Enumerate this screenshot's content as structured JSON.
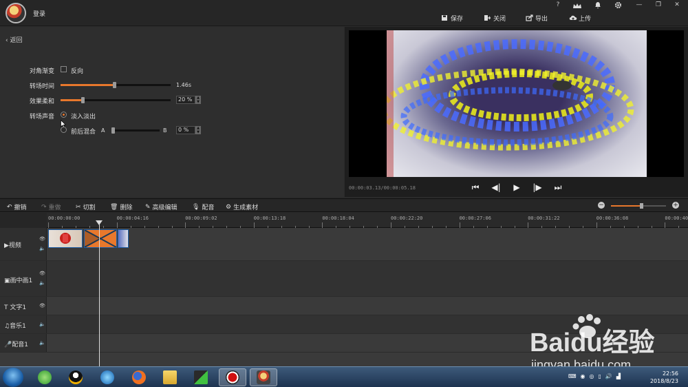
{
  "titlebar": {
    "login_label": "登录",
    "window_controls": [
      "?",
      "VIP",
      "bell-icon",
      "gear-icon",
      "—",
      "❐",
      "✕"
    ],
    "actions": [
      {
        "label": "保存",
        "icon": "save-icon"
      },
      {
        "label": "关闭",
        "icon": "close-project-icon"
      },
      {
        "label": "导出",
        "icon": "export-icon"
      },
      {
        "label": "上传",
        "icon": "upload-icon"
      }
    ]
  },
  "settings": {
    "back_label": "返回",
    "diagonal_label": "对角渐变",
    "reverse_label": "反向",
    "reverse_checked": false,
    "duration_label": "转场时间",
    "duration_value": "1.46s",
    "duration_fraction": 0.49,
    "softness_label": "效果柔和",
    "softness_value": "20 %",
    "softness_fraction": 0.2,
    "sound_label": "转场声音",
    "fade_label": "淡入淡出",
    "mix_label": "前后混合",
    "mix_a": "A",
    "mix_b": "B",
    "mix_value": "0 %",
    "mix_fraction": 0.0,
    "selected_sound": "fade"
  },
  "preview": {
    "timecode": "00:00:03.13/00:00:05.18",
    "controls": [
      "skip-start-icon",
      "step-back-icon",
      "play-icon",
      "step-forward-icon",
      "skip-end-icon"
    ]
  },
  "toolbar": {
    "undo": "撤销",
    "redo": "重做",
    "cut": "切割",
    "delete": "删除",
    "advanced_edit": "高级编辑",
    "dub": "配音",
    "generate": "生成素材",
    "zoom_fraction": 0.55
  },
  "ruler": {
    "ticks": [
      "00:00:00:00",
      "00:00:04:16",
      "00:00:09:02",
      "00:00:13:18",
      "00:00:18:04",
      "00:00:22:20",
      "00:00:27:06",
      "00:00:31:22",
      "00:00:36:08",
      "00:00:40"
    ]
  },
  "tracks": [
    {
      "name": "视频",
      "icon": "video-icon"
    },
    {
      "name": "画中画1",
      "icon": "pip-icon"
    },
    {
      "name": "文字1",
      "icon": "text-icon"
    },
    {
      "name": "音乐1",
      "icon": "music-icon"
    },
    {
      "name": "配音1",
      "icon": "mic-icon"
    }
  ],
  "taskbar": {
    "apps": [
      "browser-icon",
      "qq-icon",
      "media-player-icon",
      "firefox-icon",
      "folder-icon",
      "app-icon",
      "record-icon",
      "video-editor-icon"
    ],
    "time": "22:56",
    "date": "2018/8/23"
  },
  "watermark": {
    "brand": "Baidu经验",
    "url": "jingyan.baidu.com"
  },
  "colors": {
    "accent": "#e8782c",
    "clip_border": "#1c5ea8"
  }
}
